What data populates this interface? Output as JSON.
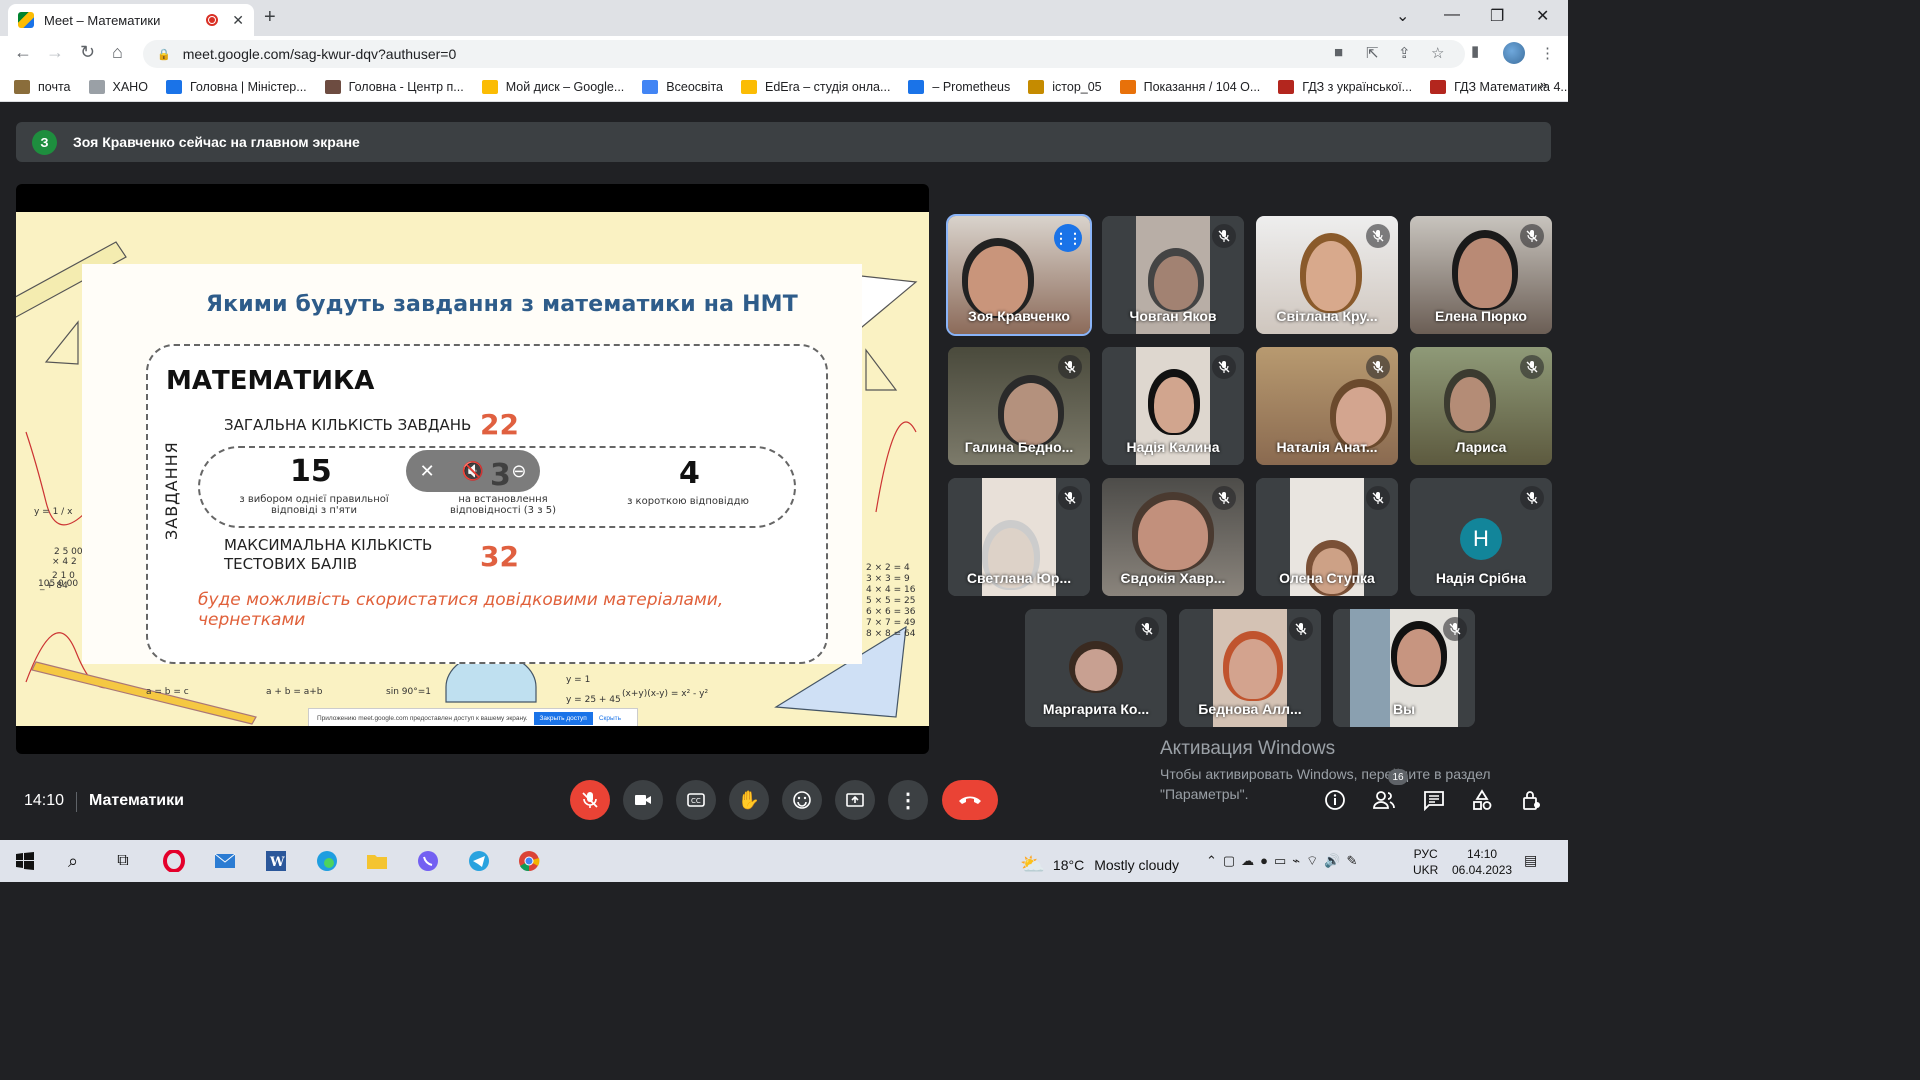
{
  "browser": {
    "tab_title": "Meet – Математики",
    "new_tab": "+",
    "url": "meet.google.com/sag-kwur-dqv?authuser=0",
    "bookmarks": [
      {
        "label": "почта",
        "color": "#8a6d3b"
      },
      {
        "label": "ХАНО",
        "color": "#9aa0a6"
      },
      {
        "label": "Головна | Міністер...",
        "color": "#1a73e8"
      },
      {
        "label": "Головна - Центр п...",
        "color": "#6d4c41"
      },
      {
        "label": "Мой диск – Google...",
        "color": "#fbbc04"
      },
      {
        "label": "Всеосвіта",
        "color": "#4285f4"
      },
      {
        "label": "EdEra – студія онла...",
        "color": "#fbbc04"
      },
      {
        "label": "– Prometheus",
        "color": "#1a73e8"
      },
      {
        "label": "істор_05",
        "color": "#c58b00"
      },
      {
        "label": "Показання / 104 О...",
        "color": "#e8710a"
      },
      {
        "label": "ГДЗ з української...",
        "color": "#b3261e"
      },
      {
        "label": "ГДЗ Математика 4...",
        "color": "#b3261e"
      }
    ],
    "more": "»"
  },
  "meet": {
    "banner_initial": "З",
    "banner_text": "Зоя Кравченко сейчас на главном экране",
    "slide": {
      "title": "Якими будуть завдання з математики на НМТ",
      "heading": "МАТЕМАТИКА",
      "total_label": "ЗАГАЛЬНА КІЛЬКІСТЬ ЗАВДАНЬ",
      "total_value": "22",
      "vertical_label": "ЗАВДАННЯ",
      "item1_value": "15",
      "item1_text": "з вибором однієї правильної відповіді з п'яти",
      "item2_value": "3",
      "item2_text": "на встановлення відповідності (3 з 5)",
      "item3_value": "4",
      "item3_text": "з короткою відповіддю",
      "max_label": "МАКСИМАЛЬНА КІЛЬКІСТЬ ТЕСТОВИХ БАЛІВ",
      "max_value": "32",
      "note": "буде можливість скористатися довідковими матеріалами, чернетками"
    },
    "share_bar": {
      "text": "Приложению meet.google.com предоставлен доступ к вашему экрану.",
      "stop": "Закрыть доступ",
      "hide": "Скрыть"
    },
    "participants": [
      {
        "name": "Зоя Кравченко",
        "speaking": true
      },
      {
        "name": "Човган Яков"
      },
      {
        "name": "Світлана Кру..."
      },
      {
        "name": "Елена Пюрко"
      },
      {
        "name": "Галина Бедно..."
      },
      {
        "name": "Надія Калина"
      },
      {
        "name": "Наталія Анат..."
      },
      {
        "name": "Лариса"
      },
      {
        "name": "Светлана Юр..."
      },
      {
        "name": "Євдокія Хавр..."
      },
      {
        "name": "Олена Ступка"
      },
      {
        "name": "Надія Срібна",
        "initial": "Н"
      },
      {
        "name": "Маргарита Ко..."
      },
      {
        "name": "Беднова Алл..."
      },
      {
        "name": "Вы"
      }
    ],
    "activation_title": "Активация Windows",
    "activation_text": "Чтобы активировать Windows, перейдите в раздел \"Параметры\".",
    "time": "14:10",
    "meeting_name": "Математики",
    "participant_count": "16",
    "accent_red": "#ea4335",
    "accent_blue": "#1a73e8"
  },
  "taskbar": {
    "weather_temp": "18°C",
    "weather_desc": "Mostly cloudy",
    "lang_top": "РУС",
    "lang_bottom": "UKR",
    "clock_time": "14:10",
    "clock_date": "06.04.2023"
  }
}
